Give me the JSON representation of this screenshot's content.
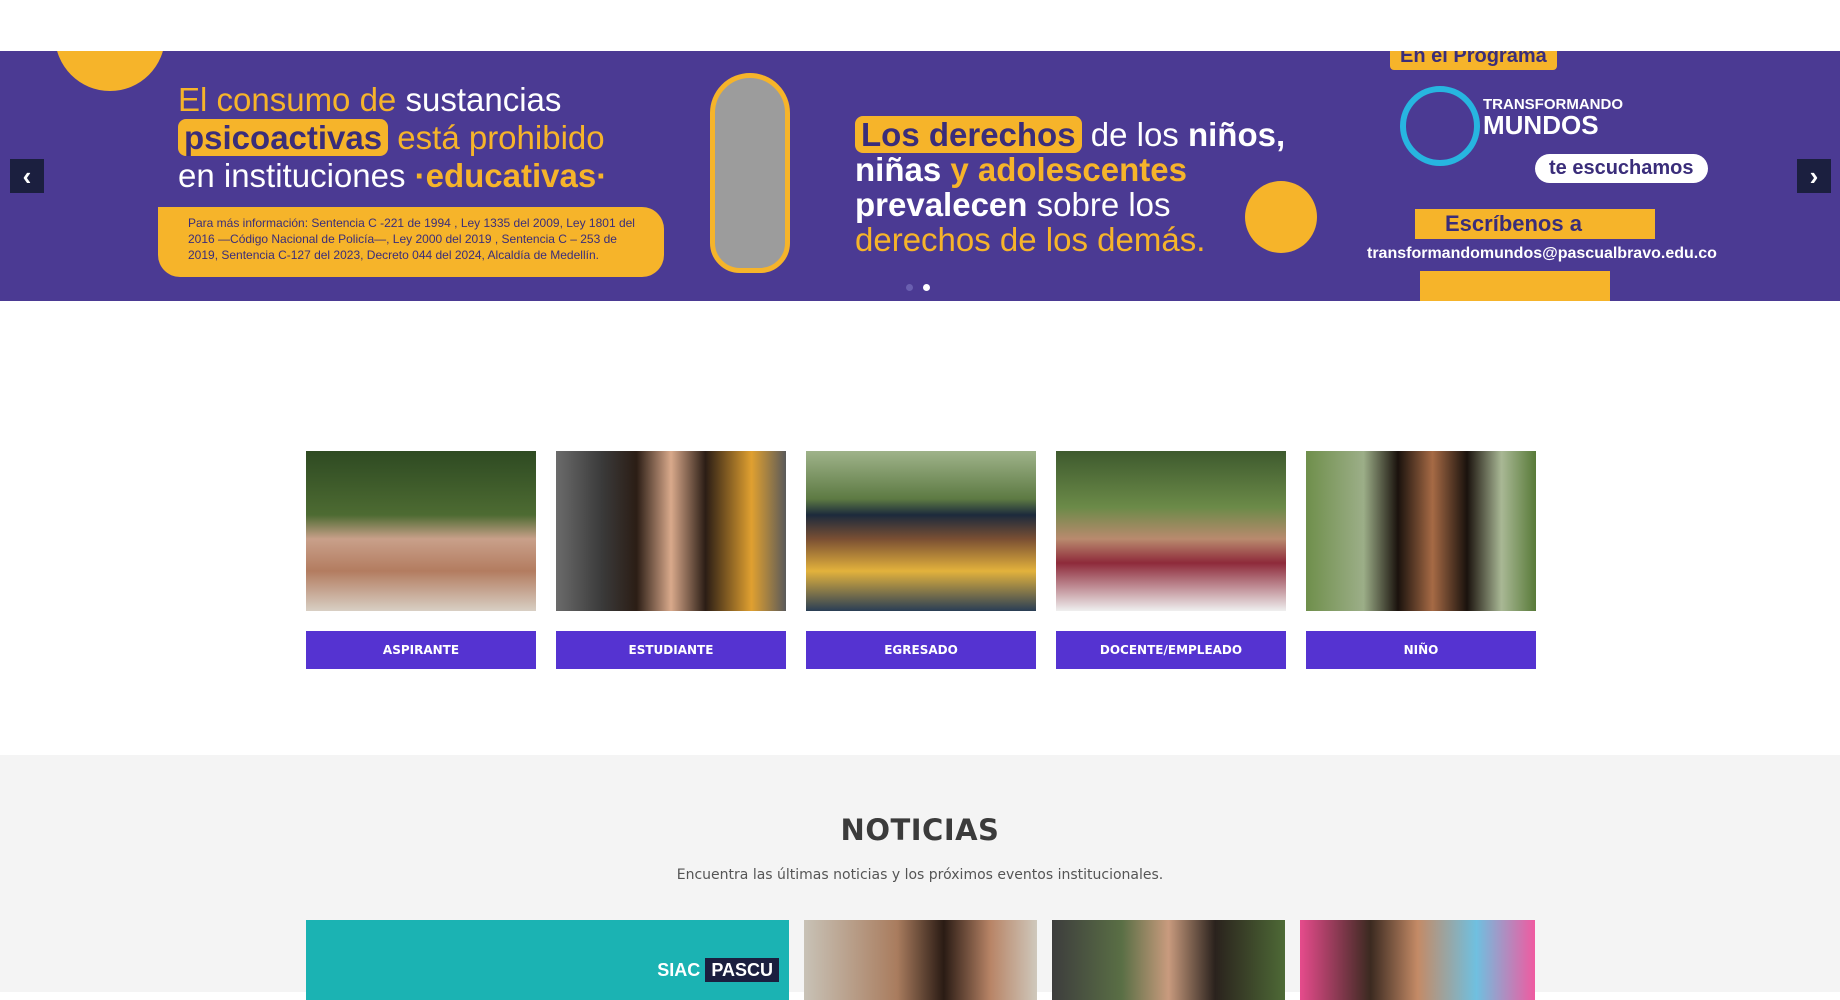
{
  "slider": {
    "prev_icon": "chevron-left-icon",
    "next_icon": "chevron-right-icon",
    "prev_label": "‹",
    "next_label": "›",
    "dots": 2,
    "active_dot": 1,
    "banner": {
      "left": {
        "line1a": "El consumo de ",
        "line1b": "sustancias",
        "line2a": "psicoactivas",
        "line2b": " está prohibido",
        "line3a": "en instituciones ",
        "line3b": "·educativas·",
        "info": "Para más información: Sentencia C -221 de 1994 , Ley 1335 del 2009, Ley 1801 del 2016 —Código Nacional de Policía—, Ley 2000 del 2019 , Sentencia C – 253 de 2019, Sentencia C-127 del 2023, Decreto 044 del 2024, Alcaldía de Medellín."
      },
      "middle": {
        "l1a": "Los derechos",
        "l1b": " de los ",
        "l1c": "niños,",
        "l2a": "niñas ",
        "l2b": "y adolescentes",
        "l3a": "prevalecen",
        "l3b": " sobre los",
        "l4": "derechos de los demás."
      },
      "right": {
        "program_tag": "En el Programa",
        "brand_small": "TRANSFORMANDO",
        "brand_big": "MUNDOS",
        "listen": "te escuchamos",
        "write": "Escríbenos a",
        "email": "transformandomundos@pascualbravo.edu.co"
      }
    },
    "colors": {
      "background": "#4b3a93",
      "accent": "#f6b42a"
    }
  },
  "profiles": [
    {
      "label": "ASPIRANTE",
      "photo": "young-man-portrait"
    },
    {
      "label": "ESTUDIANTE",
      "photo": "young-woman-portrait"
    },
    {
      "label": "EGRESADO",
      "photo": "graduate-portrait"
    },
    {
      "label": "DOCENTE/EMPLEADO",
      "photo": "woman-portrait"
    },
    {
      "label": "NIÑO",
      "photo": "child-portrait"
    }
  ],
  "news": {
    "title": "NOTICIAS",
    "subtitle": "Encuentra las últimas noticias y los próximos eventos institucionales.",
    "card1_logo": "SIAC",
    "card1_brand": "PASCU"
  },
  "colors": {
    "button": "#5533d1",
    "news_bg": "#f4f4f4"
  }
}
